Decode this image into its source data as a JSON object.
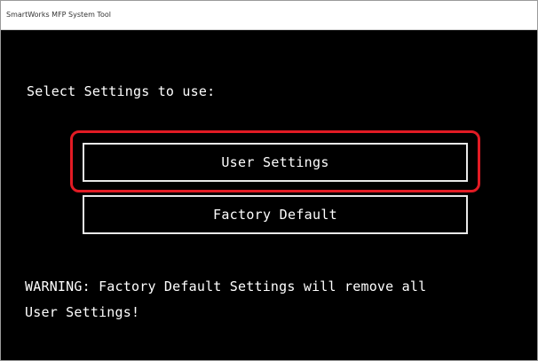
{
  "window": {
    "title": "SmartWorks MFP System Tool"
  },
  "main": {
    "prompt": "Select Settings to use:",
    "buttons": {
      "user_settings": "User Settings",
      "factory_default": "Factory Default"
    },
    "warning_line1": "WARNING: Factory Default Settings will remove all",
    "warning_line2": "User Settings!"
  },
  "colors": {
    "background": "#000000",
    "text": "#ffffff",
    "highlight": "#e21b24"
  }
}
